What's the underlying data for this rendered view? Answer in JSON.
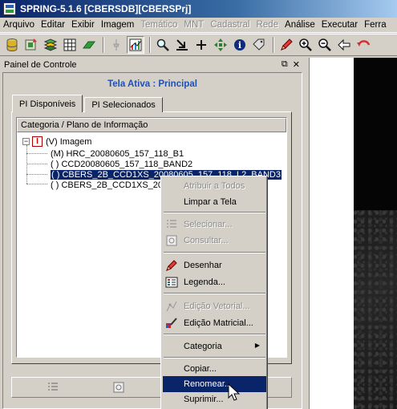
{
  "window": {
    "title": "SPRING-5.1.6 [CBERSDB][CBERSPrj]"
  },
  "menu": {
    "items": [
      {
        "label": "Arquivo",
        "enabled": true
      },
      {
        "label": "Editar",
        "enabled": true
      },
      {
        "label": "Exibir",
        "enabled": true
      },
      {
        "label": "Imagem",
        "enabled": true
      },
      {
        "label": "Temático",
        "enabled": false
      },
      {
        "label": "MNT",
        "enabled": false
      },
      {
        "label": "Cadastral",
        "enabled": false
      },
      {
        "label": "Rede",
        "enabled": false
      },
      {
        "label": "Análise",
        "enabled": true
      },
      {
        "label": "Executar",
        "enabled": true
      },
      {
        "label": "Ferra",
        "enabled": true
      }
    ]
  },
  "toolbar": {
    "icons": [
      "database-icon",
      "projects-icon",
      "layers-icon",
      "grid-icon",
      "eraser-icon",
      "pin-icon",
      "chart-icon",
      "search-icon",
      "arrow-corner-icon",
      "plus-icon",
      "pan-icon",
      "info-icon",
      "tag-icon",
      "pencil-icon",
      "zoom-in-icon",
      "zoom-out-icon",
      "back-arrow-icon",
      "undo-icon"
    ]
  },
  "panel": {
    "title": "Painel de Controle",
    "active_screen": "Tela Ativa : Principal",
    "tabs": [
      {
        "label": "PI Disponíveis",
        "active": true
      },
      {
        "label": "PI Selecionados",
        "active": false
      }
    ],
    "tree_header": "Categoria / Plano de Informação",
    "tree": {
      "expander": "−",
      "category_icon_glyph": "I",
      "category_label": "(V) Imagem",
      "items": [
        {
          "label": "(M) HRC_20080605_157_118_B1",
          "selected": false
        },
        {
          "label": "( ) CCD20080605_157_118_BAND2",
          "selected": false
        },
        {
          "label": "( ) CBERS_2B_CCD1XS_20080605_157_118_L2_BAND3",
          "selected": true
        },
        {
          "label": "( ) CBERS_2B_CCD1XS_2008",
          "selected": false
        }
      ]
    }
  },
  "context_menu": {
    "items": [
      {
        "label": "Atribuir a Todos",
        "enabled": false,
        "icon": ""
      },
      {
        "label": "Limpar a Tela",
        "enabled": true,
        "icon": ""
      },
      {
        "label": "Selecionar...",
        "enabled": false,
        "icon": "list-icon"
      },
      {
        "label": "Consultar...",
        "enabled": false,
        "icon": "query-icon"
      },
      {
        "label": "Desenhar",
        "enabled": true,
        "icon": "pencil-icon"
      },
      {
        "label": "Legenda...",
        "enabled": true,
        "icon": "legend-icon"
      },
      {
        "label": "Edição Vetorial...",
        "enabled": false,
        "icon": "vector-edit-icon"
      },
      {
        "label": "Edição Matricial...",
        "enabled": true,
        "icon": "raster-edit-icon"
      },
      {
        "label": "Categoria",
        "enabled": true,
        "icon": "",
        "submenu": true
      },
      {
        "label": "Copiar...",
        "enabled": true,
        "icon": ""
      },
      {
        "label": "Renomear...",
        "enabled": true,
        "icon": "",
        "highlighted": true
      },
      {
        "label": "Suprimir...",
        "enabled": true,
        "icon": ""
      }
    ],
    "submenu_arrow": "▶"
  },
  "colors": {
    "title_bar": "#0a246a",
    "selection": "#0a246a",
    "active_screen_text": "#1f4fb5"
  }
}
